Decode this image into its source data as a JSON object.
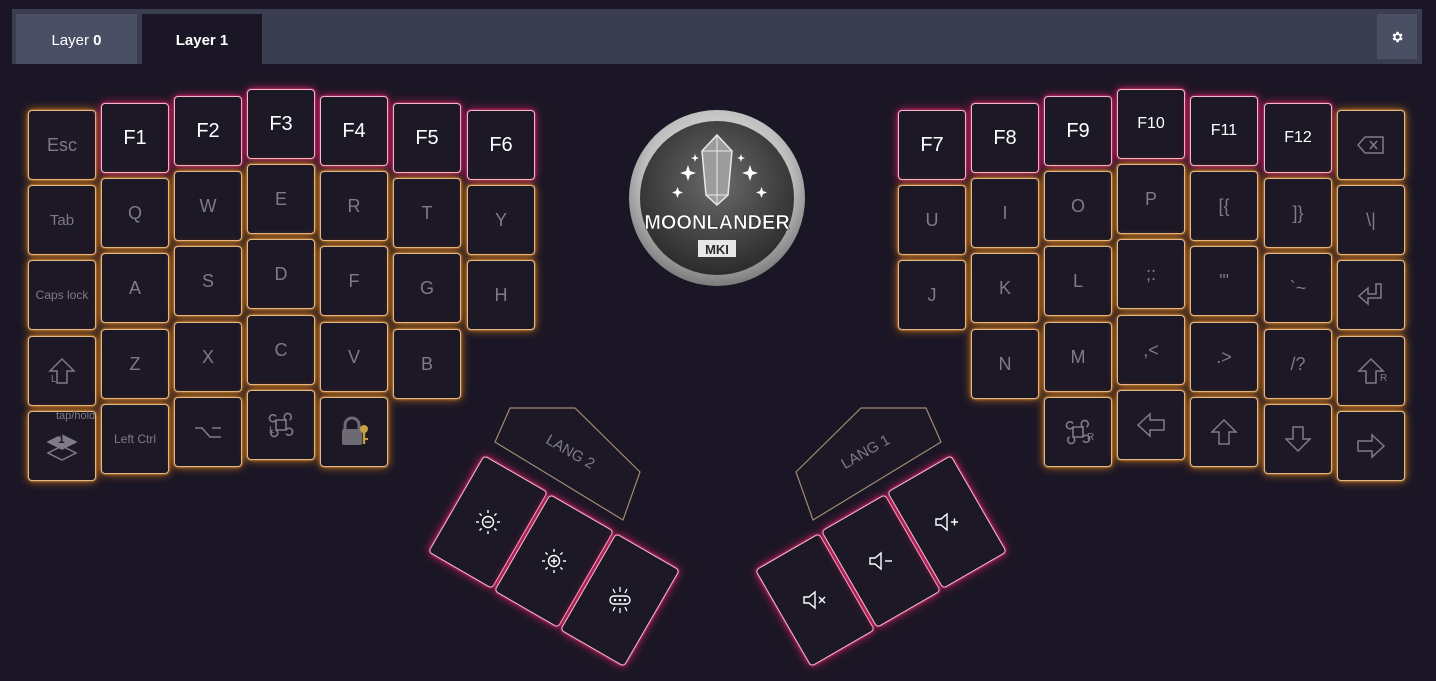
{
  "tabs": [
    {
      "label": "Layer",
      "num": "0"
    },
    {
      "label": "Layer",
      "num": "1"
    }
  ],
  "active_tab": 1,
  "settings_icon": "gear-icon",
  "colors": {
    "background": "#1b1625",
    "tabbar": "#3a3e50",
    "glow_orange": "#f28e1e",
    "glow_pink": "#ec226c",
    "transparent_key_text": "#7e7a88",
    "active_key_text": "#ffffff"
  },
  "logo": {
    "line1": "MOONLANDER",
    "line2": "MKI"
  },
  "tap_hold_label": "tap/hold",
  "keys": {
    "esc": "Esc",
    "f1": "F1",
    "f2": "F2",
    "f3": "F3",
    "f4": "F4",
    "f5": "F5",
    "f6": "F6",
    "tab": "Tab",
    "q": "Q",
    "w": "W",
    "e": "E",
    "r": "R",
    "t": "T",
    "y": "Y",
    "caps": "Caps lock",
    "a": "A",
    "s": "S",
    "d": "D",
    "f": "F",
    "g": "G",
    "h": "H",
    "z": "Z",
    "x": "X",
    "c": "C",
    "v": "V",
    "b": "B",
    "lctrl": "Left Ctrl",
    "layer_num": "1",
    "f7": "F7",
    "f8": "F8",
    "f9": "F9",
    "f10": "F10",
    "f11": "F11",
    "f12": "F12",
    "u": "U",
    "i": "I",
    "o": "O",
    "p": "P",
    "lbrace": "[{",
    "rbrace": "]}",
    "backslash": "\\|",
    "j": "J",
    "k": "K",
    "l": "L",
    "semicolon": ";:",
    "quote": "'\"",
    "grave": "`~",
    "n": "N",
    "m": "M",
    "comma": ",<",
    "period": ".>",
    "slash": "/?",
    "lang2": "LANG 2",
    "lang1": "LANG 1"
  }
}
